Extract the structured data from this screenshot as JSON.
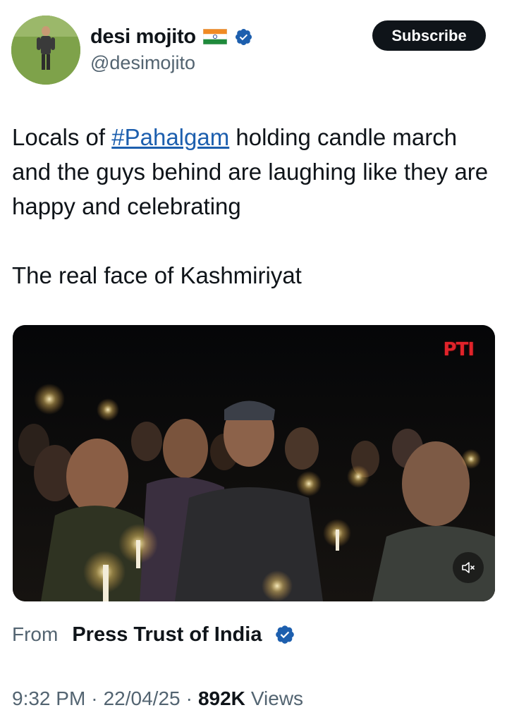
{
  "header": {
    "display_name": "desi mojito",
    "handle": "@desimojito",
    "subscribe_label": "Subscribe"
  },
  "tweet": {
    "text_before_hashtag": "Locals of ",
    "hashtag": "#Pahalgam",
    "text_after_hashtag": " holding candle march and the guys behind are laughing like they are happy and celebrating",
    "second_paragraph": "The real face of Kashmiriyat"
  },
  "media": {
    "watermark": "PTI"
  },
  "source": {
    "from_label": "From",
    "name": "Press Trust of India"
  },
  "meta": {
    "time": "9:32 PM",
    "separator": "·",
    "date": "22/04/25",
    "views_count": "892K",
    "views_label": "Views"
  },
  "colors": {
    "hashtag": "#1d5fae",
    "verified": "#1d5fae",
    "subscribe_bg": "#0f1419",
    "secondary_text": "#536471",
    "watermark": "#e0232a"
  },
  "icons": {
    "verified": "verified-badge-icon",
    "flag": "india-flag-icon",
    "mute": "speaker-muted-icon"
  }
}
